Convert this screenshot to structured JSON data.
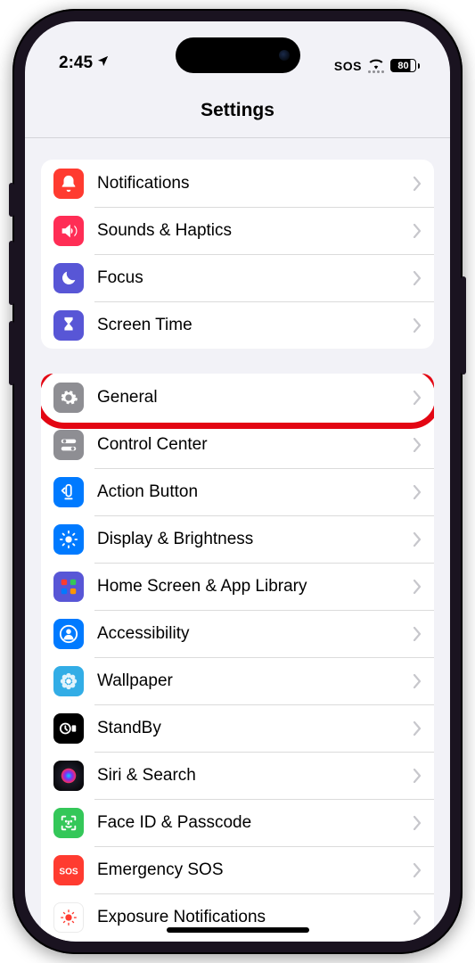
{
  "status": {
    "time": "2:45",
    "sos": "SOS",
    "battery": "80"
  },
  "header": {
    "title": "Settings"
  },
  "groups": [
    {
      "items": [
        {
          "id": "notifications",
          "label": "Notifications",
          "icon": "bell",
          "bg": "bg-red"
        },
        {
          "id": "sounds",
          "label": "Sounds & Haptics",
          "icon": "speaker",
          "bg": "bg-pink"
        },
        {
          "id": "focus",
          "label": "Focus",
          "icon": "moon",
          "bg": "bg-indigo"
        },
        {
          "id": "screentime",
          "label": "Screen Time",
          "icon": "hourglass",
          "bg": "bg-indigo"
        }
      ]
    },
    {
      "items": [
        {
          "id": "general",
          "label": "General",
          "icon": "gear",
          "bg": "bg-gray",
          "highlight": true
        },
        {
          "id": "controlcenter",
          "label": "Control Center",
          "icon": "switches",
          "bg": "bg-gray"
        },
        {
          "id": "actionbutton",
          "label": "Action Button",
          "icon": "action",
          "bg": "bg-blue"
        },
        {
          "id": "display",
          "label": "Display & Brightness",
          "icon": "sun",
          "bg": "bg-blue"
        },
        {
          "id": "homescreen",
          "label": "Home Screen & App Library",
          "icon": "grid",
          "bg": "bg-indigo"
        },
        {
          "id": "accessibility",
          "label": "Accessibility",
          "icon": "person",
          "bg": "bg-blue"
        },
        {
          "id": "wallpaper",
          "label": "Wallpaper",
          "icon": "flower",
          "bg": "bg-cyan"
        },
        {
          "id": "standby",
          "label": "StandBy",
          "icon": "clock",
          "bg": "bg-black"
        },
        {
          "id": "siri",
          "label": "Siri & Search",
          "icon": "siri",
          "bg": "bg-siri"
        },
        {
          "id": "faceid",
          "label": "Face ID & Passcode",
          "icon": "faceid",
          "bg": "bg-green"
        },
        {
          "id": "sos",
          "label": "Emergency SOS",
          "icon": "sos",
          "bg": "bg-sos"
        },
        {
          "id": "exposure",
          "label": "Exposure Notifications",
          "icon": "exposure",
          "bg": "bg-white"
        }
      ]
    }
  ]
}
